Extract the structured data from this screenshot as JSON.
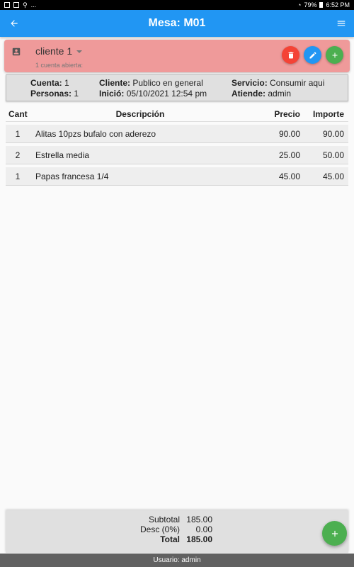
{
  "statusbar": {
    "left_text": "...",
    "battery": "79%",
    "time": "6:52 PM"
  },
  "appbar": {
    "title": "Mesa: M01",
    "back_icon": "arrow-left-icon",
    "menu_icon": "hamburger-menu-icon",
    "color": "#2196f3"
  },
  "client": {
    "name": "cliente 1",
    "subtitle": "1 cuenta abierta:",
    "card_color": "#ef9a9a",
    "icons": {
      "account": "account-box-icon",
      "delete": "trash-icon",
      "edit": "pencil-icon",
      "add": "plus-icon"
    }
  },
  "info": {
    "cuenta_label": "Cuenta:",
    "cuenta_value": "1",
    "personas_label": "Personas:",
    "personas_value": "1",
    "cliente_label": "Cliente:",
    "cliente_value": "Publico en general",
    "inicio_label": "Inició:",
    "inicio_value": "05/10/2021 12:54 pm",
    "servicio_label": "Servicio:",
    "servicio_value": "Consumir aqui",
    "atiende_label": "Atiende:",
    "atiende_value": "admin"
  },
  "table": {
    "headers": {
      "cant": "Cant",
      "descripcion": "Descripción",
      "precio": "Precio",
      "importe": "Importe"
    },
    "rows": [
      {
        "cant": "1",
        "descripcion": "Alitas 10pzs bufalo con aderezo",
        "precio": "90.00",
        "importe": "90.00"
      },
      {
        "cant": "2",
        "descripcion": "Estrella media",
        "precio": "25.00",
        "importe": "50.00"
      },
      {
        "cant": "1",
        "descripcion": "Papas francesa 1/4",
        "precio": "45.00",
        "importe": "45.00"
      }
    ]
  },
  "totals": {
    "subtotal_label": "Subtotal",
    "subtotal_value": "185.00",
    "desc_label": "Desc (0%)",
    "desc_value": "0.00",
    "total_label": "Total",
    "total_value": "185.00"
  },
  "footer": {
    "text": "Usuario: admin"
  },
  "colors": {
    "delete": "#f44336",
    "edit": "#2196f3",
    "add": "#4caf50",
    "footer": "#616161"
  }
}
